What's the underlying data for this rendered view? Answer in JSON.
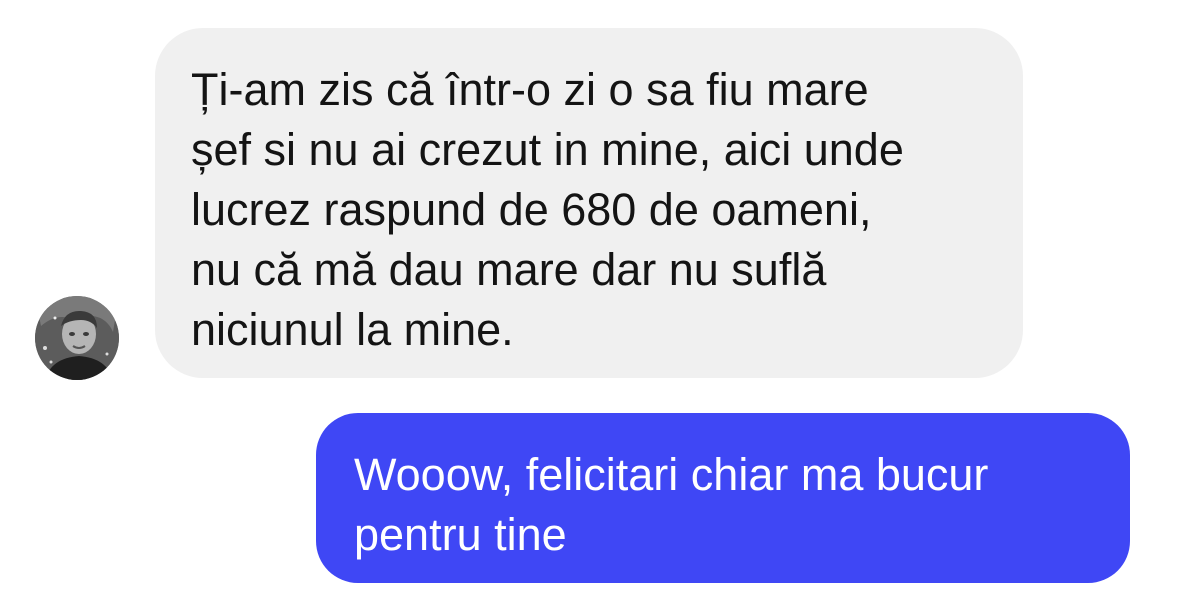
{
  "conversation": {
    "messages": [
      {
        "direction": "incoming",
        "text": "Ți-am zis că într-o zi o sa fiu mare\nșef si nu ai crezut in mine, aici unde\nlucrez raspund de 680 de oameni,\nnu că mă dau mare dar nu suflă\nniciunul la mine.",
        "has_avatar": true
      },
      {
        "direction": "outgoing",
        "text": "Wooow, felicitari chiar ma bucur\npentru tine"
      }
    ]
  },
  "colors": {
    "background": "#ffffff",
    "incoming_bubble": "#f0f0f0",
    "incoming_text": "#141414",
    "outgoing_bubble": "#3f47f5",
    "outgoing_text": "#ffffff"
  },
  "icons": {
    "avatar": "user-photo-avatar"
  }
}
